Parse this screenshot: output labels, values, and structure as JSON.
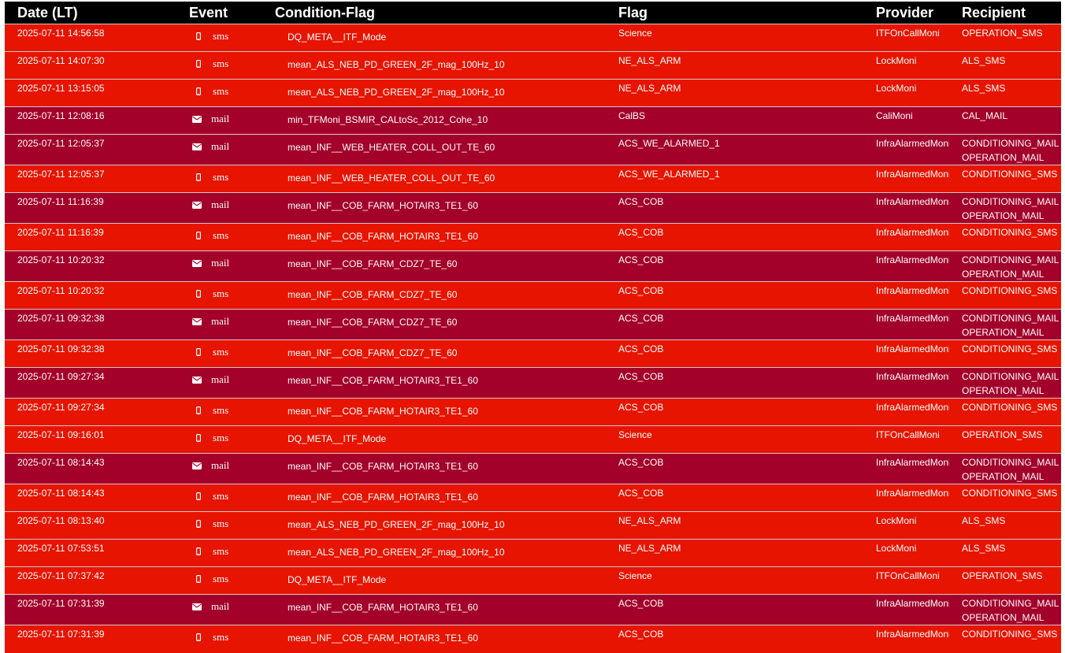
{
  "columns": {
    "date": "Date (LT)",
    "event": "Event",
    "condition": "Condition-Flag",
    "flag": "Flag",
    "provider": "Provider",
    "recipient": "Recipient"
  },
  "colors": {
    "sms_row": "#e61400",
    "mail_row": "#a3002a",
    "header": "#000000"
  },
  "icons": {
    "sms": "mobile-phone-icon",
    "mail": "envelope-icon"
  },
  "rows": [
    {
      "date": "2025-07-11 14:56:58",
      "event": "sms",
      "condition": "DQ_META__ITF_Mode",
      "flag": "Science",
      "provider": "ITFOnCallMoni",
      "recipients": [
        "OPERATION_SMS"
      ]
    },
    {
      "date": "2025-07-11 14:07:30",
      "event": "sms",
      "condition": "mean_ALS_NEB_PD_GREEN_2F_mag_100Hz_10",
      "flag": "NE_ALS_ARM",
      "provider": "LockMoni",
      "recipients": [
        "ALS_SMS"
      ]
    },
    {
      "date": "2025-07-11 13:15:05",
      "event": "sms",
      "condition": "mean_ALS_NEB_PD_GREEN_2F_mag_100Hz_10",
      "flag": "NE_ALS_ARM",
      "provider": "LockMoni",
      "recipients": [
        "ALS_SMS"
      ]
    },
    {
      "date": "2025-07-11 12:08:16",
      "event": "mail",
      "condition": "min_TFMoni_BSMIR_CALtoSc_2012_Cohe_10",
      "flag": "CalBS",
      "provider": "CaliMoni",
      "recipients": [
        "CAL_MAIL"
      ]
    },
    {
      "date": "2025-07-11 12:05:37",
      "event": "mail",
      "condition": "mean_INF__WEB_HEATER_COLL_OUT_TE_60",
      "flag": "ACS_WE_ALARMED_1",
      "provider": "InfraAlarmedMoni",
      "recipients": [
        "CONDITIONING_MAIL",
        "OPERATION_MAIL"
      ]
    },
    {
      "date": "2025-07-11 12:05:37",
      "event": "sms",
      "condition": "mean_INF__WEB_HEATER_COLL_OUT_TE_60",
      "flag": "ACS_WE_ALARMED_1",
      "provider": "InfraAlarmedMoni",
      "recipients": [
        "CONDITIONING_SMS"
      ]
    },
    {
      "date": "2025-07-11 11:16:39",
      "event": "mail",
      "condition": "mean_INF__COB_FARM_HOTAIR3_TE1_60",
      "flag": "ACS_COB",
      "provider": "InfraAlarmedMoni",
      "recipients": [
        "CONDITIONING_MAIL",
        "OPERATION_MAIL"
      ]
    },
    {
      "date": "2025-07-11 11:16:39",
      "event": "sms",
      "condition": "mean_INF__COB_FARM_HOTAIR3_TE1_60",
      "flag": "ACS_COB",
      "provider": "InfraAlarmedMoni",
      "recipients": [
        "CONDITIONING_SMS"
      ]
    },
    {
      "date": "2025-07-11 10:20:32",
      "event": "mail",
      "condition": "mean_INF__COB_FARM_CDZ7_TE_60",
      "flag": "ACS_COB",
      "provider": "InfraAlarmedMoni",
      "recipients": [
        "CONDITIONING_MAIL",
        "OPERATION_MAIL"
      ]
    },
    {
      "date": "2025-07-11 10:20:32",
      "event": "sms",
      "condition": "mean_INF__COB_FARM_CDZ7_TE_60",
      "flag": "ACS_COB",
      "provider": "InfraAlarmedMoni",
      "recipients": [
        "CONDITIONING_SMS"
      ]
    },
    {
      "date": "2025-07-11 09:32:38",
      "event": "mail",
      "condition": "mean_INF__COB_FARM_CDZ7_TE_60",
      "flag": "ACS_COB",
      "provider": "InfraAlarmedMoni",
      "recipients": [
        "CONDITIONING_MAIL",
        "OPERATION_MAIL"
      ]
    },
    {
      "date": "2025-07-11 09:32:38",
      "event": "sms",
      "condition": "mean_INF__COB_FARM_CDZ7_TE_60",
      "flag": "ACS_COB",
      "provider": "InfraAlarmedMoni",
      "recipients": [
        "CONDITIONING_SMS"
      ]
    },
    {
      "date": "2025-07-11 09:27:34",
      "event": "mail",
      "condition": "mean_INF__COB_FARM_HOTAIR3_TE1_60",
      "flag": "ACS_COB",
      "provider": "InfraAlarmedMoni",
      "recipients": [
        "CONDITIONING_MAIL",
        "OPERATION_MAIL"
      ]
    },
    {
      "date": "2025-07-11 09:27:34",
      "event": "sms",
      "condition": "mean_INF__COB_FARM_HOTAIR3_TE1_60",
      "flag": "ACS_COB",
      "provider": "InfraAlarmedMoni",
      "recipients": [
        "CONDITIONING_SMS"
      ]
    },
    {
      "date": "2025-07-11 09:16:01",
      "event": "sms",
      "condition": "DQ_META__ITF_Mode",
      "flag": "Science",
      "provider": "ITFOnCallMoni",
      "recipients": [
        "OPERATION_SMS"
      ]
    },
    {
      "date": "2025-07-11 08:14:43",
      "event": "mail",
      "condition": "mean_INF__COB_FARM_HOTAIR3_TE1_60",
      "flag": "ACS_COB",
      "provider": "InfraAlarmedMoni",
      "recipients": [
        "CONDITIONING_MAIL",
        "OPERATION_MAIL"
      ]
    },
    {
      "date": "2025-07-11 08:14:43",
      "event": "sms",
      "condition": "mean_INF__COB_FARM_HOTAIR3_TE1_60",
      "flag": "ACS_COB",
      "provider": "InfraAlarmedMoni",
      "recipients": [
        "CONDITIONING_SMS"
      ]
    },
    {
      "date": "2025-07-11 08:13:40",
      "event": "sms",
      "condition": "mean_ALS_NEB_PD_GREEN_2F_mag_100Hz_10",
      "flag": "NE_ALS_ARM",
      "provider": "LockMoni",
      "recipients": [
        "ALS_SMS"
      ]
    },
    {
      "date": "2025-07-11 07:53:51",
      "event": "sms",
      "condition": "mean_ALS_NEB_PD_GREEN_2F_mag_100Hz_10",
      "flag": "NE_ALS_ARM",
      "provider": "LockMoni",
      "recipients": [
        "ALS_SMS"
      ]
    },
    {
      "date": "2025-07-11 07:37:42",
      "event": "sms",
      "condition": "DQ_META__ITF_Mode",
      "flag": "Science",
      "provider": "ITFOnCallMoni",
      "recipients": [
        "OPERATION_SMS"
      ]
    },
    {
      "date": "2025-07-11 07:31:39",
      "event": "mail",
      "condition": "mean_INF__COB_FARM_HOTAIR3_TE1_60",
      "flag": "ACS_COB",
      "provider": "InfraAlarmedMoni",
      "recipients": [
        "CONDITIONING_MAIL",
        "OPERATION_MAIL"
      ]
    },
    {
      "date": "2025-07-11 07:31:39",
      "event": "sms",
      "condition": "mean_INF__COB_FARM_HOTAIR3_TE1_60",
      "flag": "ACS_COB",
      "provider": "InfraAlarmedMoni",
      "recipients": [
        "CONDITIONING_SMS"
      ]
    }
  ]
}
